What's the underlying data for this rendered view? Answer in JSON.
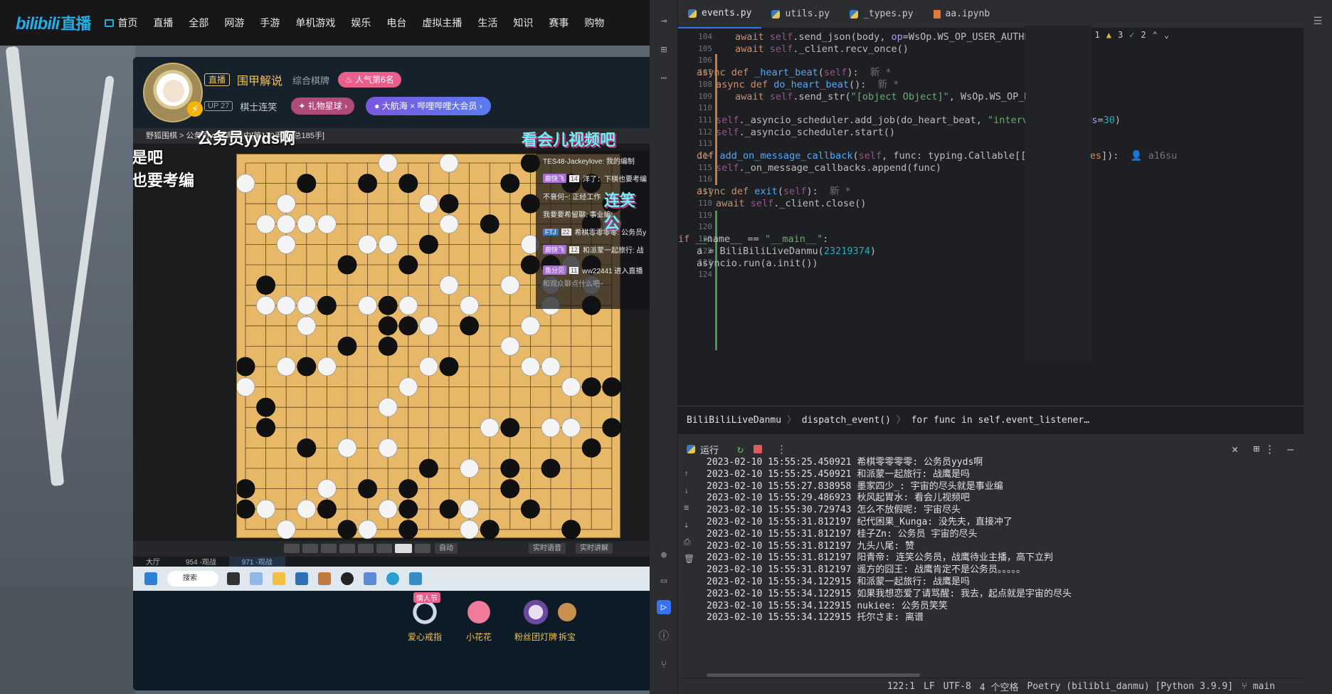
{
  "bili": {
    "logo": "bilibili",
    "logo_sub": "直播",
    "nav": [
      "首页",
      "直播",
      "全部",
      "网游",
      "手游",
      "单机游戏",
      "娱乐",
      "电台",
      "虚拟主播",
      "生活",
      "知识",
      "赛事",
      "购物"
    ],
    "room": {
      "live_badge": "直播",
      "title": "围甲解说",
      "category": "综合棋牌",
      "popularity": "人气第6名",
      "up_level": "UP 27",
      "streamer": "棋士连笑",
      "gift_ball": "礼物星球",
      "event": "大航海 × 哔哩哔哩大会员"
    },
    "video": {
      "bar_text": "野狐围棋 > 公务员yyds啊 战中[第170手] - [总185手]",
      "overlay_big": "公务员yyds啊",
      "overlay_l1": "是吧",
      "overlay_l2": "也要考编",
      "overlay_cyan1": "看会儿视频吧",
      "overlay_cyan2": "连笑公",
      "chat": [
        {
          "tag": "",
          "lv": "",
          "text": "TES48-Jackeylove: 我的编制"
        },
        {
          "tag": "廊快飞",
          "lv": "14",
          "text": "洋了：下棋也要考编"
        },
        {
          "tag": "",
          "lv": "",
          "text": "不衰何~: 正经工作"
        },
        {
          "tag": "",
          "lv": "",
          "text": "我要要希留聊: 事业编!"
        },
        {
          "tag": "FTJ",
          "lv": "22",
          "text": "希棋零零零零: 公务员y"
        },
        {
          "tag": "廊快飞",
          "lv": "12",
          "text": "和派蒙一起旅行: 战"
        },
        {
          "tag": "鱼分贝",
          "lv": "11",
          "text": "ww22441 进入直播"
        },
        {
          "tag": "",
          "lv": "",
          "text": "和观众聊点什么吧~"
        }
      ],
      "auto_btn": "自动",
      "aux1": "实时语音",
      "aux2": "实时讲解",
      "room_tabs": [
        "大厅",
        "954 -观战",
        "971 -观战"
      ]
    },
    "taskbar_search": "搜索",
    "gifts": [
      {
        "name": "爱心戒指",
        "tag": "情人节"
      },
      {
        "name": "小花花",
        "tag": ""
      },
      {
        "name": "粉丝团灯牌",
        "tag": ""
      },
      {
        "name": "拆宝",
        "tag": ""
      }
    ]
  },
  "ide": {
    "tabs": [
      {
        "label": "events.py",
        "type": "py",
        "active": true
      },
      {
        "label": "utils.py",
        "type": "py",
        "active": false
      },
      {
        "label": "_types.py",
        "type": "py",
        "active": false
      },
      {
        "label": "aa.ipynb",
        "type": "nb",
        "active": false
      }
    ],
    "inspection": {
      "warn1": "1",
      "warn2": "3",
      "ok": "2"
    },
    "line_numbers": [
      "104",
      "105",
      "106",
      "107",
      "108",
      "109",
      "110",
      "111",
      "112",
      "113",
      "114",
      "115",
      "116",
      "117",
      "118",
      "119",
      "120",
      "121",
      "122",
      "123",
      "124"
    ],
    "author_hint": "a16su",
    "new_hint": "新 *",
    "breadcrumb": [
      "BiliBiliLiveDanmu",
      "dispatch_event()",
      "for func in self.event_listener…"
    ],
    "run_label": "运行",
    "logs": [
      "2023-02-10 15:55:25.450921 希棋零零零零: 公务员yyds啊",
      "2023-02-10 15:55:25.450921 和派蒙一起旅行: 战鹰是吗",
      "2023-02-10 15:55:27.838958 墨家四少_: 宇宙的尽头就是事业编",
      "2023-02-10 15:55:29.486923 秋风起胃水: 看会儿视频吧",
      "2023-02-10 15:55:30.729743 怎么不放假呢: 宇宙尽头",
      "2023-02-10 15:55:31.812197 纪代困果_Kunga: 没先夫，直接冲了",
      "2023-02-10 15:55:31.812197 桂子Zn: 公务员 宇宙的尽头",
      "2023-02-10 15:55:31.812197 九头八尾: 赞",
      "2023-02-10 15:55:31.812197 阳青帝: 连笑公务员，战鹰待业主播，高下立判",
      "2023-02-10 15:55:31.812197 遥方的囧王: 战鹰肯定不是公务员。。。。。",
      "2023-02-10 15:55:34.122915 和派蒙一起旅行: 战鹰是吗",
      "2023-02-10 15:55:34.122915 如果我想恋爱了请骂醒: 我去，起点就是宇宙的尽头",
      "2023-02-10 15:55:34.122915 nukiee: 公务员笑笑",
      "2023-02-10 15:55:34.122915 托尔さま: 离谱"
    ],
    "status": {
      "pos": "122:1",
      "eol": "LF",
      "enc": "UTF-8",
      "indent": "4 个空格",
      "interp": "Poetry (bilibli_danmu) [Python 3.9.9]",
      "branch": "main"
    }
  }
}
